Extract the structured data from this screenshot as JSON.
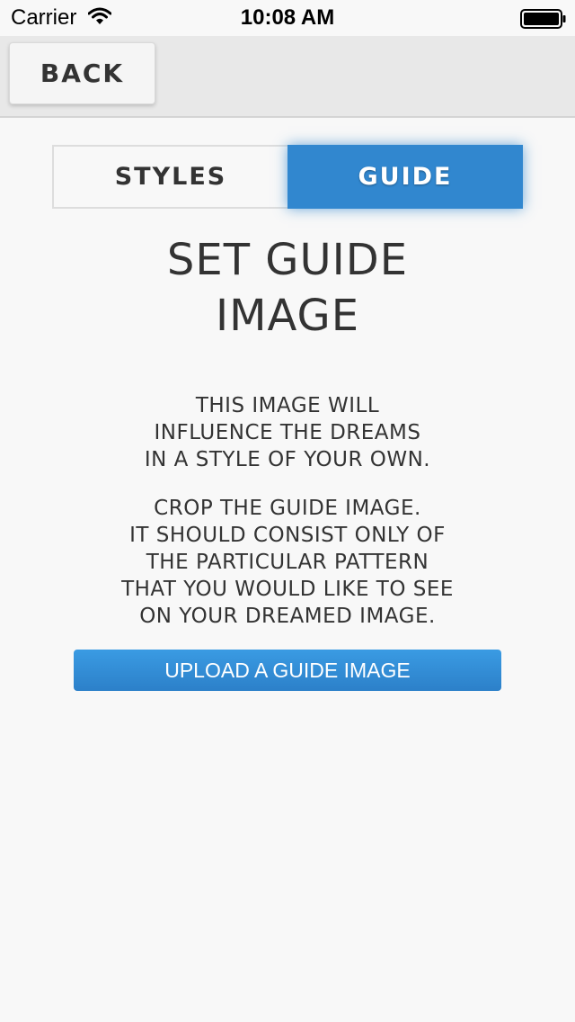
{
  "status_bar": {
    "carrier": "Carrier",
    "time": "10:08 AM",
    "wifi_icon": "wifi-icon",
    "battery_icon": "battery-icon"
  },
  "nav": {
    "back_label": "BACK"
  },
  "segmented_control": {
    "tabs": [
      {
        "label": "STYLES",
        "selected": false
      },
      {
        "label": "GUIDE",
        "selected": true
      }
    ],
    "accent_color": "#3187cf"
  },
  "main": {
    "heading_lines": [
      "SET GUIDE",
      "IMAGE"
    ],
    "paragraph_1_lines": [
      "THIS IMAGE WILL",
      "INFLUENCE THE DREAMS",
      "IN A STYLE OF YOUR OWN."
    ],
    "paragraph_2_lines": [
      "CROP THE GUIDE IMAGE.",
      "IT SHOULD CONSIST ONLY OF",
      "THE PARTICULAR PATTERN",
      "THAT YOU WOULD LIKE TO SEE",
      "ON YOUR DREAMED IMAGE."
    ],
    "upload_button_label": "UPLOAD A GUIDE IMAGE"
  }
}
